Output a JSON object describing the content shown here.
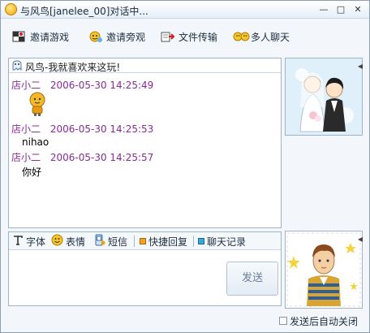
{
  "window": {
    "title": "与风鸟[janelee_00]对话中...",
    "controls": {
      "minimize": "—",
      "maximize": "□",
      "close": "✕"
    }
  },
  "toolbar": {
    "invite_game": "邀请游戏",
    "invite_watch": "邀请旁观",
    "file_transfer": "文件传输",
    "group_chat": "多人聊天"
  },
  "chat": {
    "header": "风鸟-我就喜欢来这玩!",
    "messages": [
      {
        "sender": "店小二",
        "time": "2006-05-30 14:25:49",
        "text": ""
      },
      {
        "sender": "店小二",
        "time": "2006-05-30 14:25:53",
        "text": "nihao"
      },
      {
        "sender": "店小二",
        "time": "2006-05-30 14:25:57",
        "text": "你好"
      }
    ]
  },
  "input_toolbar": {
    "font": "字体",
    "emoticon": "表情",
    "sms": "短信",
    "quick_reply": "快捷回复",
    "history": "聊天记录"
  },
  "send_button": "发送",
  "footer": {
    "auto_close_label": "发送后自动关闭",
    "auto_close_checked": false
  },
  "colors": {
    "sender_color": "#8b2a9b",
    "window_bg": "#f3f7fc",
    "border": "#9fb3c8"
  },
  "icons": [
    "chat-app-icon",
    "game-icon",
    "watch-icon",
    "file-icon",
    "group-icon",
    "ghost-icon",
    "font-icon",
    "smile-icon",
    "sms-icon",
    "quick-reply-icon",
    "history-icon"
  ]
}
